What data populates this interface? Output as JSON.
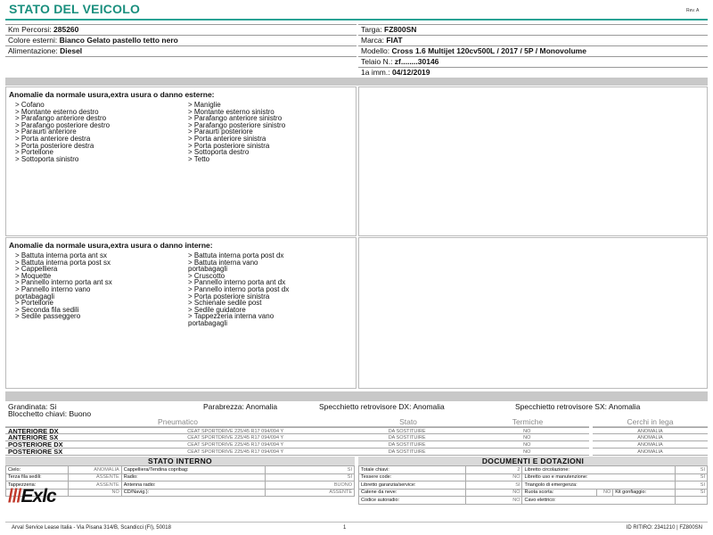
{
  "header": {
    "title": "STATO DEL VEICOLO",
    "rev": "Rev. A"
  },
  "vehicle_left": [
    {
      "label": "Km Percorsi: ",
      "value": "285260"
    },
    {
      "label": "Colore esterni: ",
      "value": "Bianco Gelato pastello tetto nero"
    },
    {
      "label": "Alimentazione: ",
      "value": "Diesel"
    }
  ],
  "vehicle_right": [
    {
      "label": "Targa: ",
      "value": "FZ800SN"
    },
    {
      "label": "Marca: ",
      "value": "FIAT"
    },
    {
      "label": "Modello: ",
      "value": "Cross 1.6 Multijet 120cv500L / 2017 / 5P / Monovolume"
    },
    {
      "label": "Telaio N.: ",
      "value": "zf........30146"
    },
    {
      "label": "1a imm.: ",
      "value": "04/12/2019"
    }
  ],
  "external_damage": {
    "title": "Anomalie da normale usura,extra usura o danno esterne:",
    "col1": [
      "> Cofano",
      "> Montante esterno destro",
      "> Parafango anteriore destro",
      "> Parafango posteriore destro",
      "> Paraurti anteriore",
      "> Porta anteriore destra",
      "> Porta posteriore destra",
      "> Portellone",
      "> Sottoporta sinistro"
    ],
    "col2": [
      "> Maniglie",
      "> Montante esterno sinistro",
      "> Parafango anteriore sinistro",
      "> Parafango posteriore sinistro",
      "> Paraurti posteriore",
      "> Porta anteriore sinistra",
      "> Porta posteriore sinistra",
      "> Sottoporta destro",
      "> Tetto"
    ]
  },
  "internal_damage": {
    "title": "Anomalie da normale usura,extra usura o danno interne:",
    "col1": [
      "> Battuta interna porta ant sx",
      "> Battuta interna porta post sx",
      "> Cappelliera",
      "> Moquette",
      "> Pannello interno porta ant sx",
      "> Pannello interno vano",
      "portabagagli",
      "> Portellone",
      "> Seconda fila sedili",
      "> Sedile passeggero"
    ],
    "col2": [
      "> Battuta interna porta post dx",
      "> Battuta interna vano",
      "portabagagli",
      "> Cruscotto",
      "> Pannello interno porta ant dx",
      "> Pannello interno porta post dx",
      "> Porta posteriore sinistra",
      "> Schienale sedile post",
      "> Sedile guidatore",
      "> Tappezzeria interna vano",
      "portabagagli"
    ]
  },
  "summary": {
    "grandinata": "Grandinata: Si",
    "parabrezza": "Parabrezza: Anomalia",
    "specchietto_dx": "Specchietto retrovisore DX: Anomalia",
    "specchietto_sx": "Specchietto retrovisore SX: Anomalia",
    "blocchetto": "Blocchetto chiavi: Buono"
  },
  "tyres": {
    "headers": {
      "pneumatico": "Pneumatico",
      "stato": "Stato",
      "termiche": "Termiche",
      "cerchi": "Cerchi in lega"
    },
    "rows": [
      {
        "pos": "ANTERIORE DX",
        "tyre": "CEAT SPORTDRIVE 225/45 R17 094/094 Y",
        "stato": "DA SOSTITUIRE",
        "termiche": "NO",
        "cerchi": "ANOMALIA"
      },
      {
        "pos": "ANTERIORE SX",
        "tyre": "CEAT SPORTDRIVE 225/45 R17 094/094 Y",
        "stato": "DA SOSTITUIRE",
        "termiche": "NO",
        "cerchi": "ANOMALIA"
      },
      {
        "pos": "POSTERIORE DX",
        "tyre": "CEAT SPORTDRIVE 225/45 R17 094/094 Y",
        "stato": "DA SOSTITUIRE",
        "termiche": "NO",
        "cerchi": "ANOMALIA"
      },
      {
        "pos": "POSTERIORE SX",
        "tyre": "CEAT SPORTDRIVE 225/45 R17 094/094 Y",
        "stato": "DA SOSTITUIRE",
        "termiche": "NO",
        "cerchi": "ANOMALIA"
      }
    ]
  },
  "stato_interno": {
    "title": "STATO INTERNO",
    "rows": [
      [
        "Cielo:",
        "ANOMALIA",
        "Cappelliera/Tendina copribag:",
        "SI"
      ],
      [
        "Terza fila sedili:",
        "ASSENTE",
        "Radio:",
        "SI"
      ],
      [
        "Tappezzeria:",
        "ASSENTE",
        "Antenna radio:",
        "BUONO"
      ],
      [
        "",
        "NO",
        "CD/Navig.):",
        "ASSENTE"
      ]
    ]
  },
  "documenti": {
    "title": "DOCUMENTI E DOTAZIONI",
    "rows": [
      [
        "Totale chiavi:",
        "2",
        "Libretto circolazione:",
        "SI",
        "",
        ""
      ],
      [
        "Tessere code:",
        "NO",
        "Libretto uso e manutenzione:",
        "SI",
        "",
        ""
      ],
      [
        "Libretto garanzia/service:",
        "SI",
        "Triangolo di emergenza:",
        "SI",
        "",
        ""
      ],
      [
        "Catene da neve:",
        "NO",
        "Ruota scorta:",
        "NO",
        "Kit gonfiaggio:",
        "SI"
      ],
      [
        "Codice autoradio:",
        "NO",
        "Cavo elettrico:",
        "",
        "",
        ""
      ]
    ]
  },
  "logo": {
    "bars": "///",
    "text1": "E",
    "x": "x",
    "text2": "lc"
  },
  "footer": {
    "address": "Arval Service Lease Italia - Via Pisana 314/B, Scandicci (FI), 50018",
    "page": "1",
    "id": "ID RITIRO: 2341210 | FZ800SN"
  }
}
